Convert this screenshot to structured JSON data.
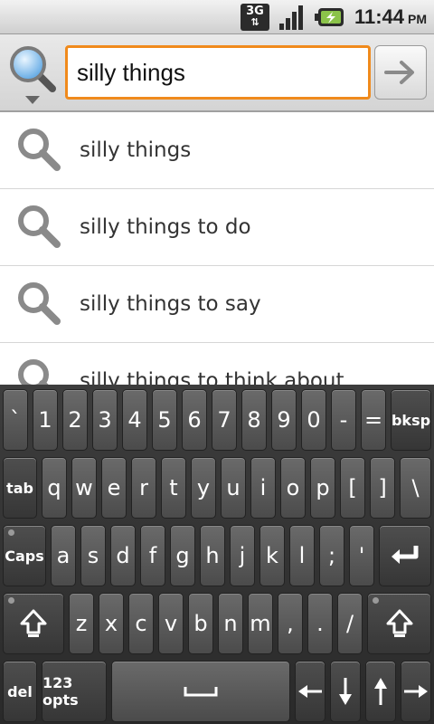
{
  "status_bar": {
    "network": "3G",
    "time": "11:44",
    "ampm": "PM"
  },
  "search": {
    "query": "silly things",
    "placeholder": ""
  },
  "suggestions": [
    "silly things",
    "silly things to do",
    "silly things to say",
    "silly things to think about"
  ],
  "keyboard": {
    "row1": [
      "`",
      "1",
      "2",
      "3",
      "4",
      "5",
      "6",
      "7",
      "8",
      "9",
      "0",
      "-",
      "=",
      "bksp"
    ],
    "row2": [
      "tab",
      "q",
      "w",
      "e",
      "r",
      "t",
      "y",
      "u",
      "i",
      "o",
      "p",
      "[",
      "]",
      "\\"
    ],
    "row3": [
      "Caps",
      "a",
      "s",
      "d",
      "f",
      "g",
      "h",
      "j",
      "k",
      "l",
      ";",
      "'"
    ],
    "row4": [
      "z",
      "x",
      "c",
      "v",
      "b",
      "n",
      "m",
      ",",
      ".",
      "/"
    ],
    "row5": [
      "del",
      "123 opts"
    ]
  },
  "colors": {
    "focus_border": "#f08a1c",
    "suggestion_text": "#333333"
  }
}
